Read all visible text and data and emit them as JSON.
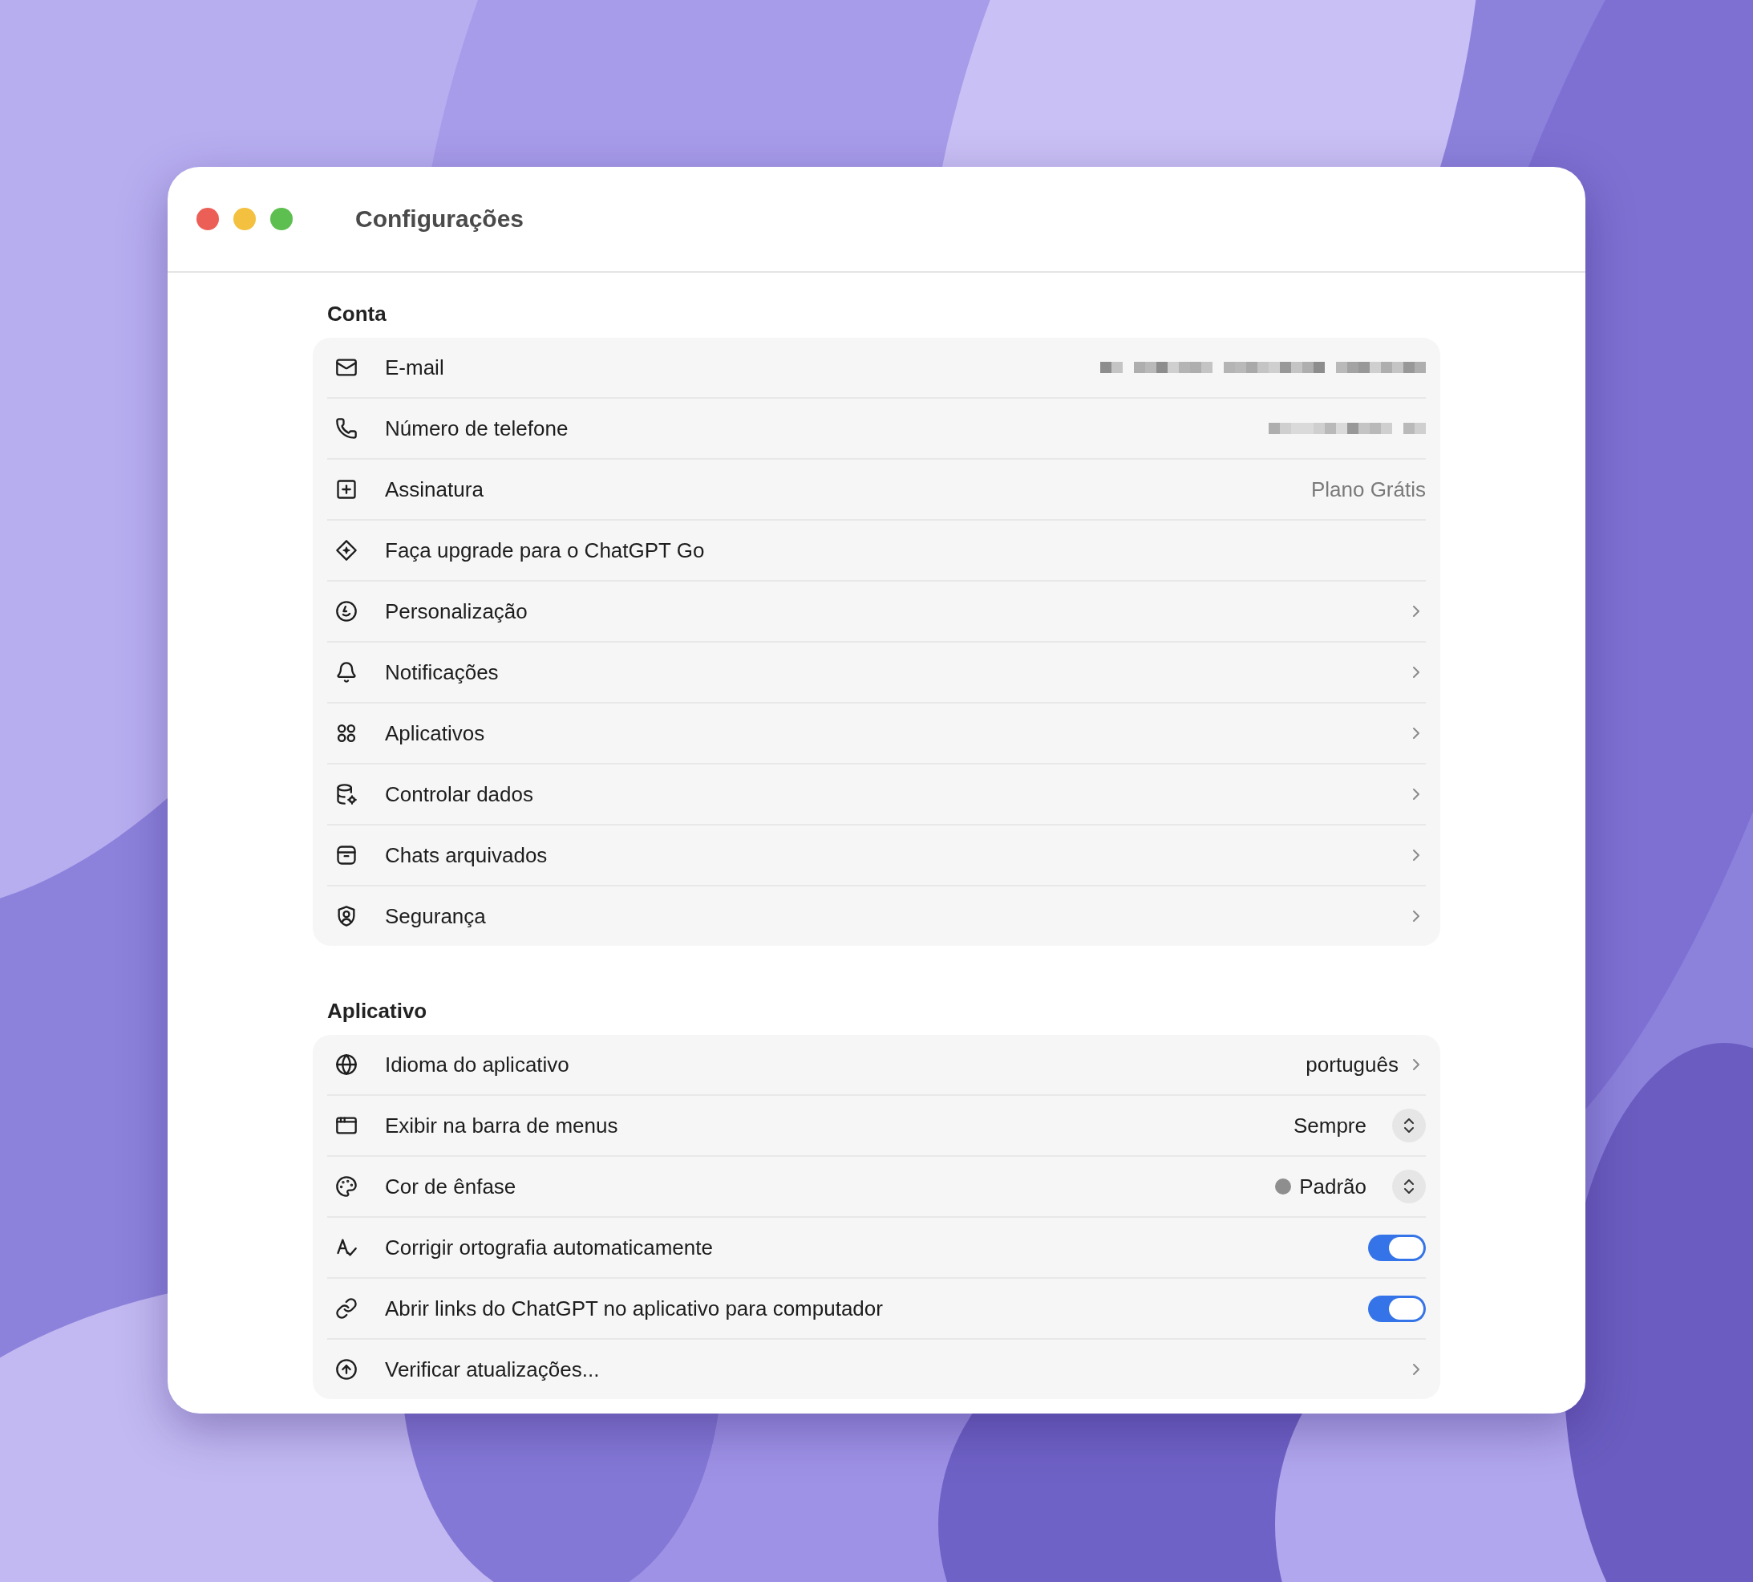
{
  "window": {
    "title": "Configurações"
  },
  "sections": [
    {
      "title": "Conta",
      "rows": [
        {
          "kind": "redacted",
          "label": "E-mail"
        },
        {
          "kind": "redacted",
          "label": "Número de telefone"
        },
        {
          "kind": "value",
          "label": "Assinatura",
          "value": "Plano Grátis"
        },
        {
          "kind": "plain",
          "label": "Faça upgrade para o ChatGPT Go"
        },
        {
          "kind": "link",
          "label": "Personalização"
        },
        {
          "kind": "link",
          "label": "Notificações"
        },
        {
          "kind": "link",
          "label": "Aplicativos"
        },
        {
          "kind": "link",
          "label": "Controlar dados"
        },
        {
          "kind": "link",
          "label": "Chats arquivados"
        },
        {
          "kind": "link",
          "label": "Segurança"
        }
      ]
    },
    {
      "title": "Aplicativo",
      "rows": [
        {
          "kind": "link",
          "label": "Idioma do aplicativo",
          "value": "português"
        },
        {
          "kind": "select",
          "label": "Exibir na barra de menus",
          "value": "Sempre"
        },
        {
          "kind": "select",
          "label": "Cor de ênfase",
          "value": "Padrão",
          "color": "#8e8e8e"
        },
        {
          "kind": "toggle",
          "label": "Corrigir ortografia automaticamente",
          "on": true
        },
        {
          "kind": "toggle",
          "label": "Abrir links do ChatGPT no aplicativo para computador",
          "on": true
        },
        {
          "kind": "link",
          "label": "Verificar atualizações..."
        }
      ]
    }
  ]
}
